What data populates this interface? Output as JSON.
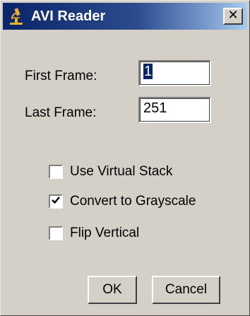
{
  "window": {
    "title": "AVI Reader",
    "close_label": "✕"
  },
  "fields": {
    "first_frame": {
      "label": "First Frame:",
      "value": "1"
    },
    "last_frame": {
      "label": "Last Frame:",
      "value": "251"
    }
  },
  "options": [
    {
      "label": "Use Virtual Stack",
      "checked": false
    },
    {
      "label": "Convert to Grayscale",
      "checked": true
    },
    {
      "label": "Flip Vertical",
      "checked": false
    }
  ],
  "buttons": {
    "ok_label": "OK",
    "cancel_label": "Cancel"
  },
  "colors": {
    "title_bar": "#0a246a",
    "dialog_background": "#d4d0c8"
  },
  "icons": {
    "app": "microscope-icon",
    "close": "close-icon",
    "check": "checkmark-icon"
  }
}
